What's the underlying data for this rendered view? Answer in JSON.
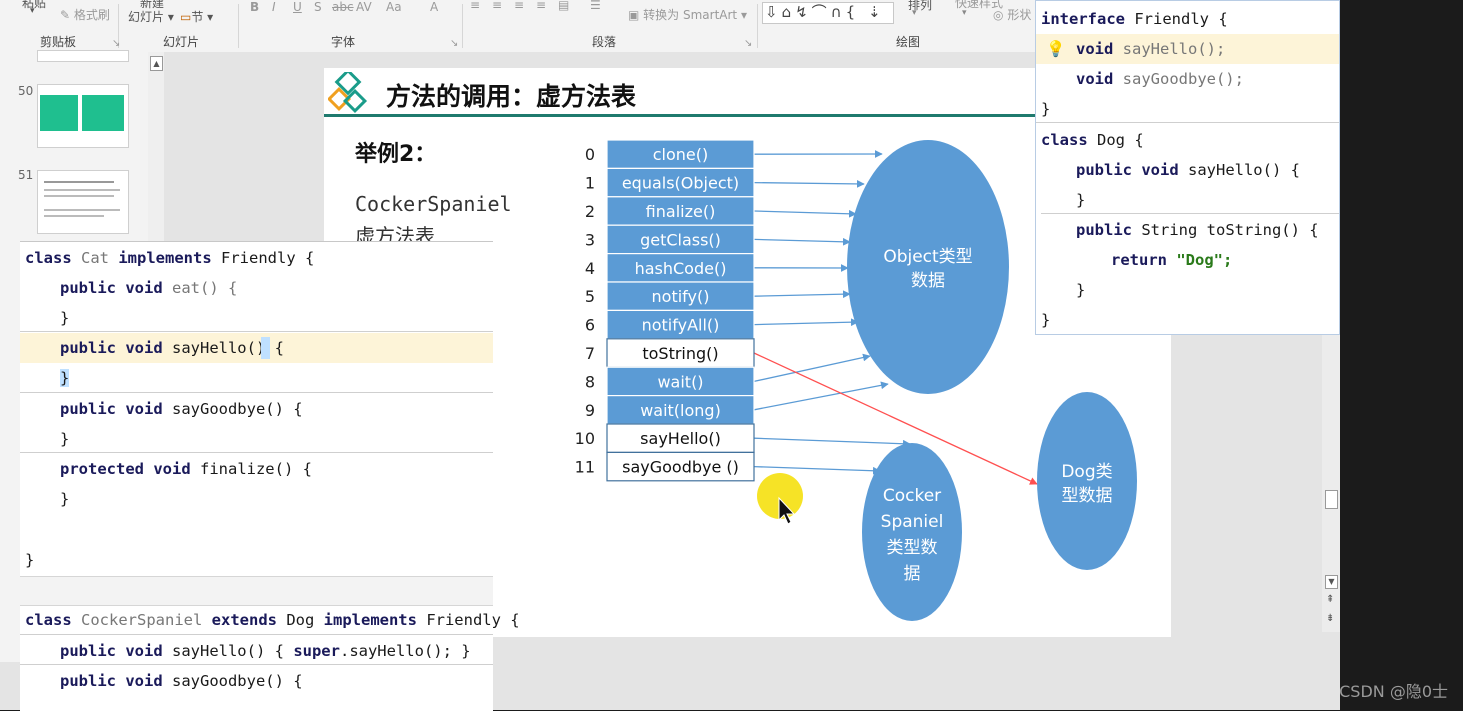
{
  "ribbon": {
    "paste_label": "粘贴",
    "format_painter": "格式刷",
    "new_slide": "新建",
    "slides_button": "幻灯片",
    "section_button": "节",
    "groups": {
      "clipboard": "剪贴板",
      "slides": "幻灯片",
      "font": "字体",
      "paragraph": "段落",
      "drawing": "绘图"
    },
    "smartart": "转换为 SmartArt",
    "arrange": "排列",
    "quick_styles": "快速样式",
    "shape_label": "形状",
    "font_buttons": [
      "B",
      "I",
      "U",
      "S",
      "abc",
      "AV",
      "Aa",
      "A"
    ]
  },
  "thumbnails": {
    "numbers": [
      "50",
      "51"
    ]
  },
  "slide": {
    "title": "方法的调用：虚方法表",
    "example_label": "举例2：",
    "class_name": "CockerSpaniel",
    "sub_label": "虚方法表"
  },
  "vtable": {
    "indices": [
      "0",
      "1",
      "2",
      "3",
      "4",
      "5",
      "6",
      "7",
      "8",
      "9",
      "10",
      "11"
    ],
    "methods": [
      "clone()",
      "equals(Object)",
      "finalize()",
      "getClass()",
      "hashCode()",
      "notify()",
      "notifyAll()",
      "toString()",
      "wait()",
      "wait(long)",
      "sayHello()",
      "sayGoodbye ()"
    ],
    "filled": [
      true,
      true,
      true,
      true,
      true,
      true,
      true,
      false,
      true,
      true,
      false,
      false
    ]
  },
  "ellipses": {
    "object": [
      "Object类型",
      "数据"
    ],
    "dog": [
      "Dog类",
      "型数据"
    ],
    "cocker": [
      "Cocker",
      "Spaniel",
      "类型数",
      "据"
    ]
  },
  "colors": {
    "cell_fill": "#5b9bd5",
    "ellipse_fill": "#5b9bd5",
    "arrow_blue": "#5b9bd5",
    "arrow_red": "#ff5050",
    "title_line": "#1f7a6e"
  },
  "code_top": {
    "lines": [
      [
        "interface",
        " Friendly {"
      ],
      [
        "void",
        " sayHello();"
      ],
      [
        "void",
        " sayGoodbye();"
      ],
      [
        "}",
        ""
      ],
      [
        "class",
        " Dog {"
      ],
      [
        "public void",
        " sayHello() {"
      ],
      [
        "}",
        ""
      ],
      [
        "public",
        " String toString() {"
      ],
      [
        "return",
        " \"Dog\";"
      ],
      [
        "}",
        ""
      ],
      [
        "}",
        ""
      ]
    ]
  },
  "code_left": {
    "cat_line": [
      "class",
      " Cat ",
      "implements",
      " Friendly {"
    ],
    "lines": [
      [
        "public void",
        " eat() {"
      ],
      [
        "}",
        ""
      ],
      [
        "public void",
        " sayHello() {"
      ],
      [
        "}",
        ""
      ],
      [
        "public void",
        " sayGoodbye() {"
      ],
      [
        "}",
        ""
      ],
      [
        "protected void",
        " finalize() {"
      ],
      [
        "}",
        ""
      ],
      [
        "}",
        ""
      ]
    ],
    "cocker_line": [
      "class",
      " CockerSpaniel ",
      "extends",
      " Dog ",
      "implements",
      " Friendly {"
    ],
    "cocker_lines": [
      [
        "public void",
        " sayHello() { ",
        "super",
        ".sayHello(); }"
      ],
      [
        "public void",
        " sayGoodbye() {"
      ]
    ]
  },
  "watermark": "CSDN @隐0士"
}
